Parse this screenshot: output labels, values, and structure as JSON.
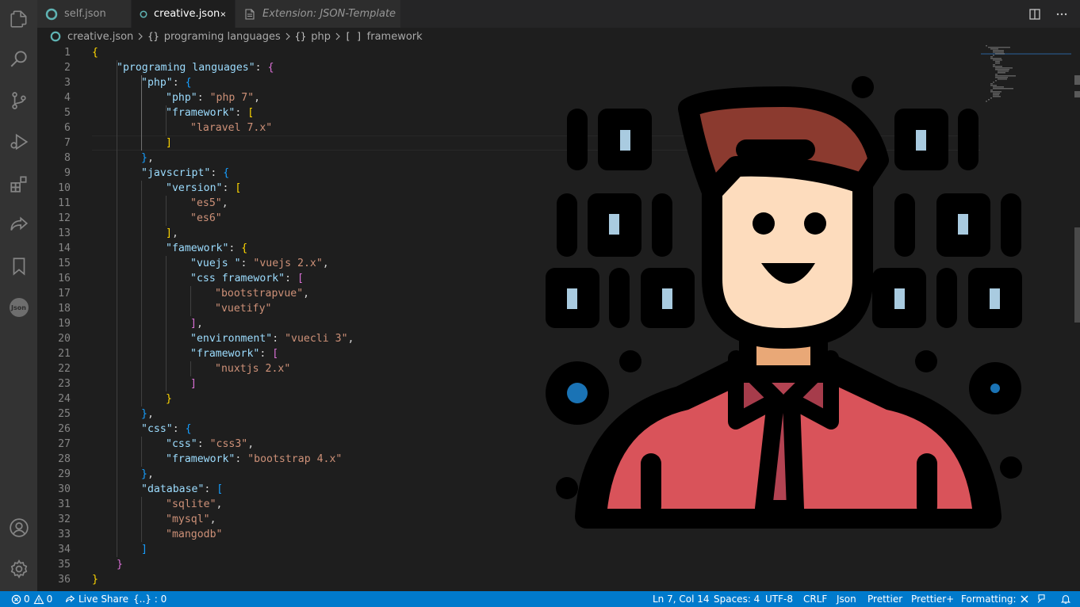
{
  "tabs": [
    {
      "label": "self.json"
    },
    {
      "label": "creative.json"
    },
    {
      "label": "Extension: JSON-Template"
    }
  ],
  "breadcrumb": {
    "file": "creative.json",
    "items": [
      {
        "symbol": "{}",
        "label": "programing languages"
      },
      {
        "symbol": "{}",
        "label": "php"
      },
      {
        "symbol": "[ ]",
        "label": "framework"
      }
    ]
  },
  "editor": {
    "line_numbers": [
      "1",
      "2",
      "3",
      "4",
      "5",
      "6",
      "7",
      "8",
      "9",
      "10",
      "11",
      "12",
      "13",
      "14",
      "15",
      "16",
      "17",
      "18",
      "19",
      "20",
      "21",
      "22",
      "23",
      "24",
      "25",
      "26",
      "27",
      "28",
      "29",
      "30",
      "31",
      "32",
      "33",
      "34",
      "35",
      "36"
    ],
    "lines": [
      [
        [
          "b1",
          "{"
        ]
      ],
      [
        [
          "k",
          "\"programing languages\""
        ],
        [
          "p",
          ": "
        ],
        [
          "b2",
          "{"
        ]
      ],
      [
        [
          "k",
          "\"php\""
        ],
        [
          "p",
          ": "
        ],
        [
          "b3",
          "{"
        ]
      ],
      [
        [
          "k",
          "\"php\""
        ],
        [
          "p",
          ": "
        ],
        [
          "s",
          "\"php 7\""
        ],
        [
          "p",
          ","
        ]
      ],
      [
        [
          "k",
          "\"framework\""
        ],
        [
          "p",
          ": "
        ],
        [
          "b1",
          "["
        ]
      ],
      [
        [
          "s",
          "\"laravel 7.x\""
        ]
      ],
      [
        [
          "b1",
          "]"
        ]
      ],
      [
        [
          "b3",
          "}"
        ],
        [
          "p",
          ","
        ]
      ],
      [
        [
          "k",
          "\"javscript\""
        ],
        [
          "p",
          ": "
        ],
        [
          "b3",
          "{"
        ]
      ],
      [
        [
          "k",
          "\"version\""
        ],
        [
          "p",
          ": "
        ],
        [
          "b1",
          "["
        ]
      ],
      [
        [
          "s",
          "\"es5\""
        ],
        [
          "p",
          ","
        ]
      ],
      [
        [
          "s",
          "\"es6\""
        ]
      ],
      [
        [
          "b1",
          "]"
        ],
        [
          "p",
          ","
        ]
      ],
      [
        [
          "k",
          "\"famework\""
        ],
        [
          "p",
          ": "
        ],
        [
          "b1",
          "{"
        ]
      ],
      [
        [
          "k",
          "\"vuejs \""
        ],
        [
          "p",
          ": "
        ],
        [
          "s",
          "\"vuejs 2.x\""
        ],
        [
          "p",
          ","
        ]
      ],
      [
        [
          "k",
          "\"css framework\""
        ],
        [
          "p",
          ": "
        ],
        [
          "b2",
          "["
        ]
      ],
      [
        [
          "s",
          "\"bootstrapvue\""
        ],
        [
          "p",
          ","
        ]
      ],
      [
        [
          "s",
          "\"vuetify\""
        ]
      ],
      [
        [
          "b2",
          "]"
        ],
        [
          "p",
          ","
        ]
      ],
      [
        [
          "k",
          "\"environment\""
        ],
        [
          "p",
          ": "
        ],
        [
          "s",
          "\"vuecli 3\""
        ],
        [
          "p",
          ","
        ]
      ],
      [
        [
          "k",
          "\"framework\""
        ],
        [
          "p",
          ": "
        ],
        [
          "b2",
          "["
        ]
      ],
      [
        [
          "s",
          "\"nuxtjs 2.x\""
        ]
      ],
      [
        [
          "b2",
          "]"
        ]
      ],
      [
        [
          "b1",
          "}"
        ]
      ],
      [
        [
          "b3",
          "}"
        ],
        [
          "p",
          ","
        ]
      ],
      [
        [
          "k",
          "\"css\""
        ],
        [
          "p",
          ": "
        ],
        [
          "b3",
          "{"
        ]
      ],
      [
        [
          "k",
          "\"css\""
        ],
        [
          "p",
          ": "
        ],
        [
          "s",
          "\"css3\""
        ],
        [
          "p",
          ","
        ]
      ],
      [
        [
          "k",
          "\"framework\""
        ],
        [
          "p",
          ": "
        ],
        [
          "s",
          "\"bootstrap 4.x\""
        ]
      ],
      [
        [
          "b3",
          "}"
        ],
        [
          "p",
          ","
        ]
      ],
      [
        [
          "k",
          "\"database\""
        ],
        [
          "p",
          ": "
        ],
        [
          "b3",
          "["
        ]
      ],
      [
        [
          "s",
          "\"sqlite\""
        ],
        [
          "p",
          ","
        ]
      ],
      [
        [
          "s",
          "\"mysql\""
        ],
        [
          "p",
          ","
        ]
      ],
      [
        [
          "s",
          "\"mangodb\""
        ]
      ],
      [
        [
          "b3",
          "]"
        ]
      ],
      [
        [
          "b2",
          "}"
        ]
      ],
      [
        [
          "b1",
          "}"
        ]
      ]
    ]
  },
  "statusbar": {
    "errors": "0",
    "warnings": "0",
    "live_share": "Live Share",
    "json_count": "{..} : 0",
    "position": "Ln 7, Col 14",
    "spaces": "Spaces: 4",
    "encoding": "UTF-8",
    "eol": "CRLF",
    "language": "Json",
    "prettier": "Prettier",
    "prettier_plus": "Prettier+",
    "formatting": "Formatting:"
  },
  "activity_bar": {
    "json_badge": "Json",
    "icons": [
      "files-icon",
      "search-icon",
      "source-control-icon",
      "run-debug-icon",
      "extensions-icon",
      "live-share-icon",
      "bookmarks-icon",
      "json-icon",
      "account-icon",
      "settings-gear-icon"
    ]
  },
  "colors": {
    "accent": "#007acc",
    "editor_bg": "#1e1e1e",
    "string": "#ce9178",
    "key": "#9cdcfe",
    "bracket_gold": "#ffd700",
    "bracket_orchid": "#da70d6",
    "bracket_blue": "#179fff",
    "shirt": "#d9535a",
    "hair": "#8b3a2f",
    "skin": "#fddcbd"
  }
}
